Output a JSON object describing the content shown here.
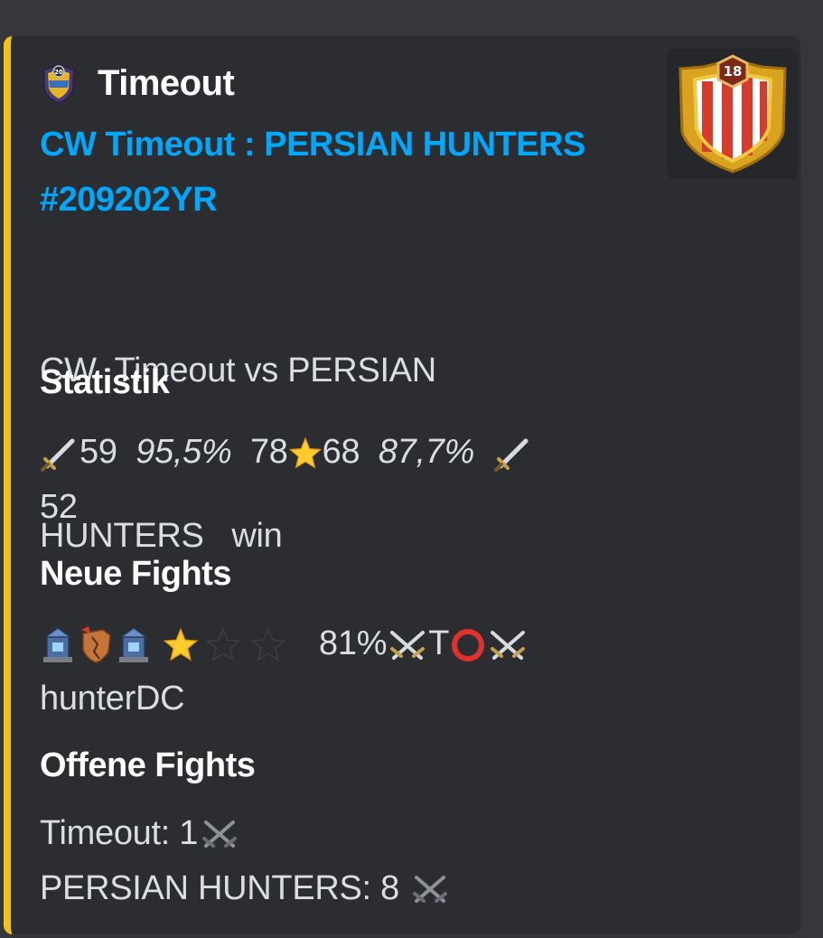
{
  "embed": {
    "accent_color": "#f0c316",
    "author": {
      "name": "Timeout",
      "icon": "clan-badge-icon"
    },
    "title": {
      "line1": "CW Timeout : PERSIAN HUNTERS",
      "line2": "#209202YR",
      "color": "#00a8fc"
    },
    "description": {
      "line1": "CW  Timeout vs PERSIAN",
      "line2": "HUNTERS   win"
    },
    "thumbnail": {
      "icon": "clan-badge-large-icon",
      "level": "18"
    },
    "fields": {
      "statistik": {
        "name": "Statistik",
        "attacks_left": "59",
        "destruction_left": "95,5%",
        "stars_left": "78",
        "stars_right": "68",
        "destruction_right": "87,7%",
        "attacks_right": "52"
      },
      "neue_fights": {
        "name": "Neue Fights",
        "stars_earned": 1,
        "stars_total": 3,
        "percent": "81%",
        "result_letter": "T",
        "player": "hunterDC"
      },
      "offene_fights": {
        "name": "Offene Fights",
        "line1_label": "Timeout: 1",
        "line2_label": "PERSIAN HUNTERS: 8"
      }
    }
  }
}
